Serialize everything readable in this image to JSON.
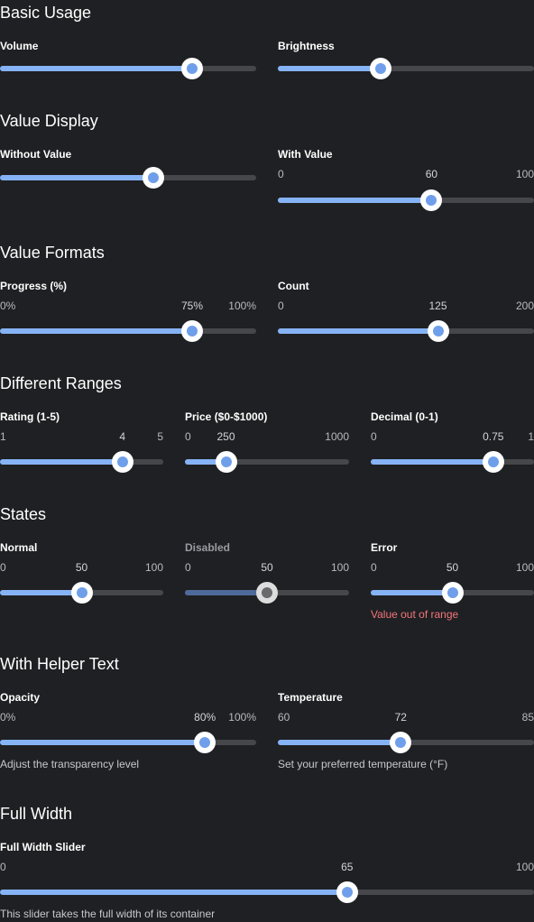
{
  "sections": {
    "basic": "Basic Usage",
    "value_display": "Value Display",
    "value_formats": "Value Formats",
    "ranges": "Different Ranges",
    "states": "States",
    "helper": "With Helper Text",
    "full_width": "Full Width"
  },
  "basic": {
    "volume": {
      "label": "Volume",
      "value": 75,
      "min": 0,
      "max": 100
    },
    "brightness": {
      "label": "Brightness",
      "value": 40,
      "min": 0,
      "max": 100
    }
  },
  "value_display": {
    "without_value": {
      "label": "Without Value",
      "value": 60,
      "min": 0,
      "max": 100
    },
    "with_value": {
      "label": "With Value",
      "min_text": "0",
      "value_text": "60",
      "max_text": "100",
      "value": 60,
      "min": 0,
      "max": 100
    }
  },
  "value_formats": {
    "progress": {
      "label": "Progress (%)",
      "min_text": "0%",
      "value_text": "75%",
      "max_text": "100%",
      "value": 75,
      "min": 0,
      "max": 100
    },
    "count": {
      "label": "Count",
      "min_text": "0",
      "value_text": "125",
      "max_text": "200",
      "value": 125,
      "min": 0,
      "max": 200
    }
  },
  "ranges": {
    "rating": {
      "label": "Rating (1-5)",
      "min_text": "1",
      "value_text": "4",
      "max_text": "5",
      "value": 4,
      "min": 1,
      "max": 5
    },
    "price": {
      "label": "Price ($0-$1000)",
      "min_text": "0",
      "value_text": "250",
      "max_text": "1000",
      "value": 250,
      "min": 0,
      "max": 1000
    },
    "decimal": {
      "label": "Decimal (0-1)",
      "min_text": "0",
      "value_text": "0.75",
      "max_text": "1",
      "value": 0.75,
      "min": 0,
      "max": 1
    }
  },
  "states": {
    "normal": {
      "label": "Normal",
      "min_text": "0",
      "value_text": "50",
      "max_text": "100",
      "value": 50,
      "min": 0,
      "max": 100
    },
    "disabled": {
      "label": "Disabled",
      "min_text": "0",
      "value_text": "50",
      "max_text": "100",
      "value": 50,
      "min": 0,
      "max": 100
    },
    "error": {
      "label": "Error",
      "min_text": "0",
      "value_text": "50",
      "max_text": "100",
      "value": 50,
      "min": 0,
      "max": 100,
      "helper": "Value out of range"
    }
  },
  "helper": {
    "opacity": {
      "label": "Opacity",
      "min_text": "0%",
      "value_text": "80%",
      "max_text": "100%",
      "value": 80,
      "min": 0,
      "max": 100,
      "helper": "Adjust the transparency level"
    },
    "temperature": {
      "label": "Temperature",
      "min_text": "60",
      "value_text": "72",
      "max_text": "85",
      "value": 72,
      "min": 60,
      "max": 85,
      "helper": "Set your preferred temperature (°F)"
    }
  },
  "full_width": {
    "slider": {
      "label": "Full Width Slider",
      "min_text": "0",
      "value_text": "65",
      "max_text": "100",
      "value": 65,
      "min": 0,
      "max": 100,
      "helper": "This slider takes the full width of its container"
    }
  },
  "colors": {
    "background": "#1f2023",
    "accent": "#86b3f5",
    "track": "#46474b",
    "error": "#f2757b"
  }
}
